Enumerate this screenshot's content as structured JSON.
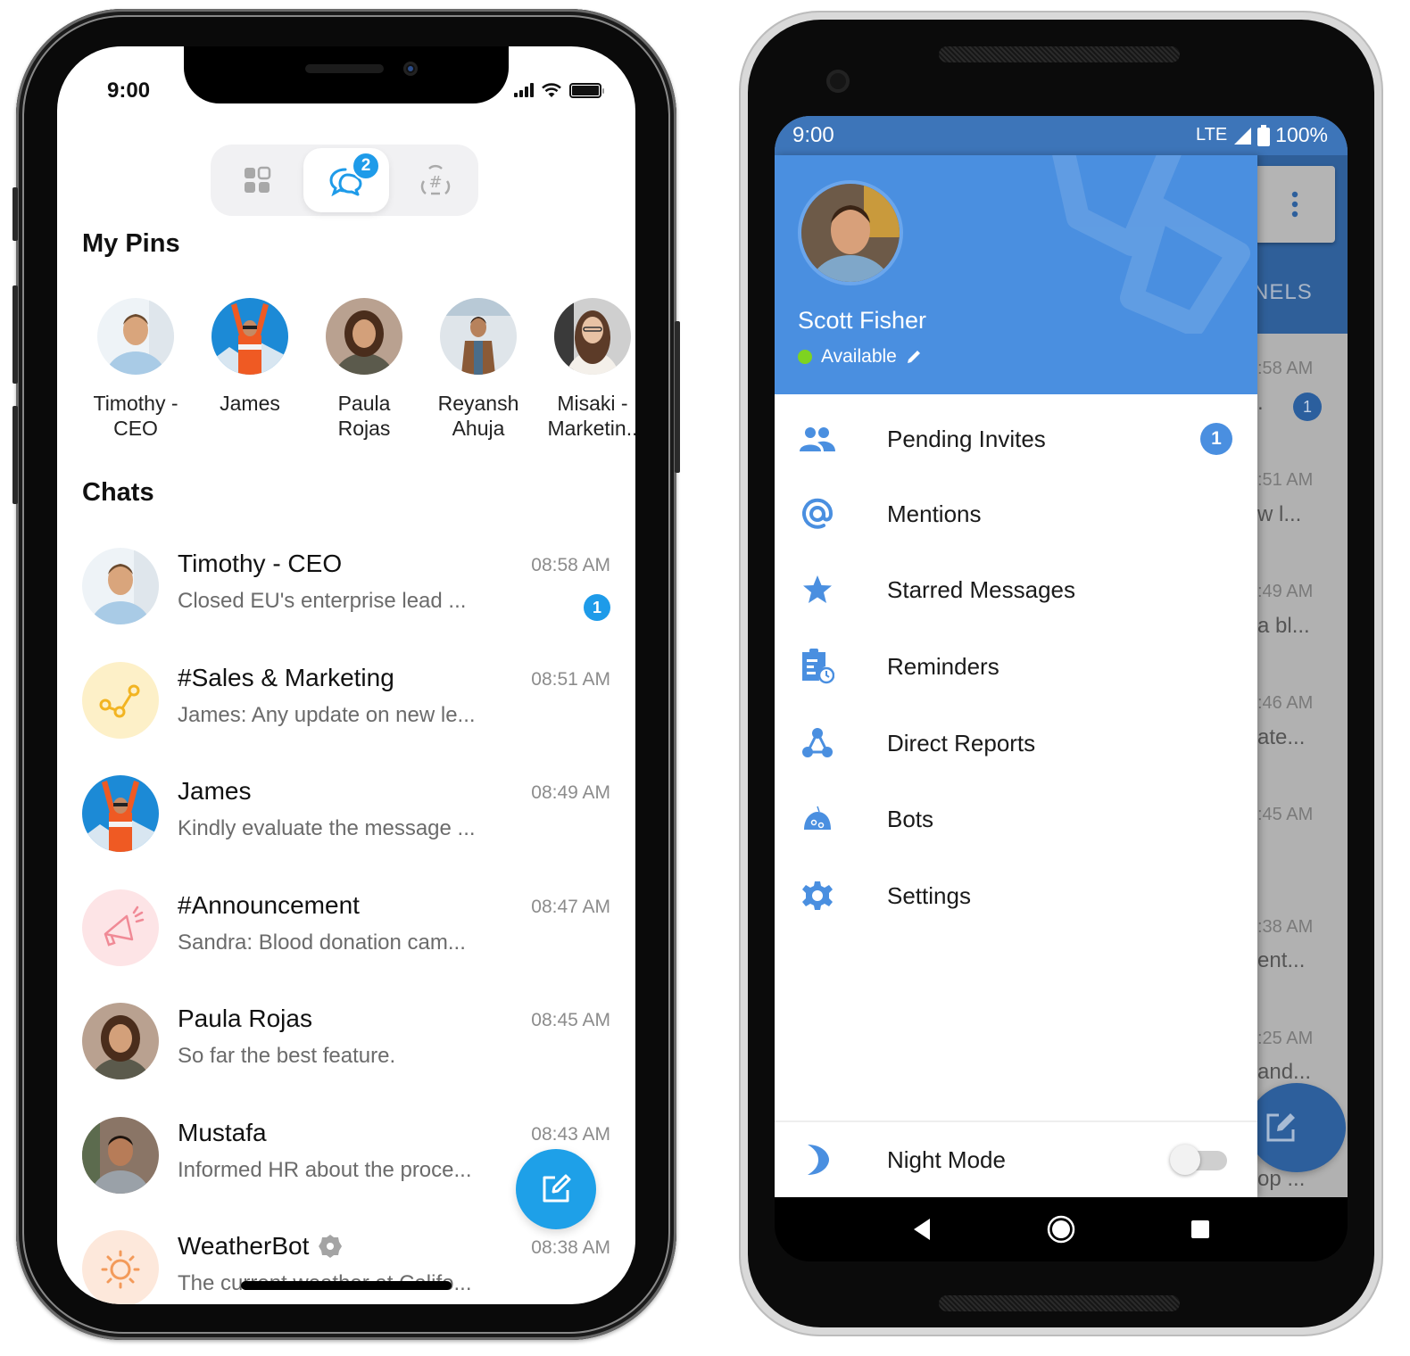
{
  "iphone": {
    "status_bar": {
      "time": "9:00"
    },
    "segmented_tabs": [
      {
        "name": "apps",
        "icon": "grid-icon",
        "active": false
      },
      {
        "name": "chats",
        "icon": "chat-bubbles-icon",
        "active": true,
        "badge": "2"
      },
      {
        "name": "channels",
        "icon": "channel-hash-icon",
        "active": false
      }
    ],
    "pins_heading": "My Pins",
    "pins": [
      {
        "name": "Timothy -\nCEO",
        "avatar": "photo-timothy"
      },
      {
        "name": "James",
        "avatar": "photo-james"
      },
      {
        "name": "Paula\nRojas",
        "avatar": "photo-paula"
      },
      {
        "name": "Reyansh\nAhuja",
        "avatar": "photo-reyansh"
      },
      {
        "name": "Misaki -\nMarketin..",
        "avatar": "photo-misaki"
      }
    ],
    "chats_heading": "Chats",
    "chats": [
      {
        "name": "Timothy - CEO",
        "time": "08:58 AM",
        "preview": "Closed EU's enterprise lead ...",
        "badge": "1",
        "avatar": "photo-timothy"
      },
      {
        "name": "#Sales & Marketing",
        "time": "08:51 AM",
        "preview": "James: Any update on new le...",
        "avatar": "channel-sales-icon"
      },
      {
        "name": "James",
        "time": "08:49 AM",
        "preview": "Kindly evaluate the message ...",
        "avatar": "photo-james"
      },
      {
        "name": "#Announcement",
        "time": "08:47 AM",
        "preview": "Sandra: Blood donation cam...",
        "avatar": "megaphone-icon"
      },
      {
        "name": "Paula Rojas",
        "time": "08:45 AM",
        "preview": "So far the best feature.",
        "avatar": "photo-paula"
      },
      {
        "name": "Mustafa",
        "time": "08:43 AM",
        "preview": "Informed HR about the proce...",
        "avatar": "photo-mustafa"
      },
      {
        "name": "WeatherBot",
        "time": "08:38 AM",
        "preview": "The current weather at Califo...",
        "avatar": "sun-icon",
        "bot": true
      }
    ],
    "fab": "compose-icon"
  },
  "android": {
    "status_bar": {
      "time": "9:00",
      "network": "LTE",
      "battery": "100%"
    },
    "profile": {
      "name": "Scott Fisher",
      "status": "Available",
      "status_color": "#7ed321"
    },
    "menu": [
      {
        "label": "Pending Invites",
        "icon": "people-icon",
        "badge": "1"
      },
      {
        "label": "Mentions",
        "icon": "at-sign-icon"
      },
      {
        "label": "Starred Messages",
        "icon": "star-icon"
      },
      {
        "label": "Reminders",
        "icon": "reminder-clipboard-icon"
      },
      {
        "label": "Direct Reports",
        "icon": "org-hierarchy-icon"
      },
      {
        "label": "Bots",
        "icon": "bot-icon"
      },
      {
        "label": "Settings",
        "icon": "gear-icon"
      }
    ],
    "night_mode": {
      "label": "Night Mode",
      "enabled": false
    },
    "background": {
      "tab_fragment": "NELS",
      "times": [
        ":58 AM",
        ":51 AM",
        ":49 AM",
        ":46 AM",
        ":45 AM",
        ":38 AM",
        ":25 AM"
      ],
      "previews": [
        ".",
        "w l...",
        "a bl...",
        "ate...",
        "",
        "ent...",
        "and...",
        "op ..."
      ],
      "badge": "1"
    },
    "accent": "#4a8fe0"
  }
}
